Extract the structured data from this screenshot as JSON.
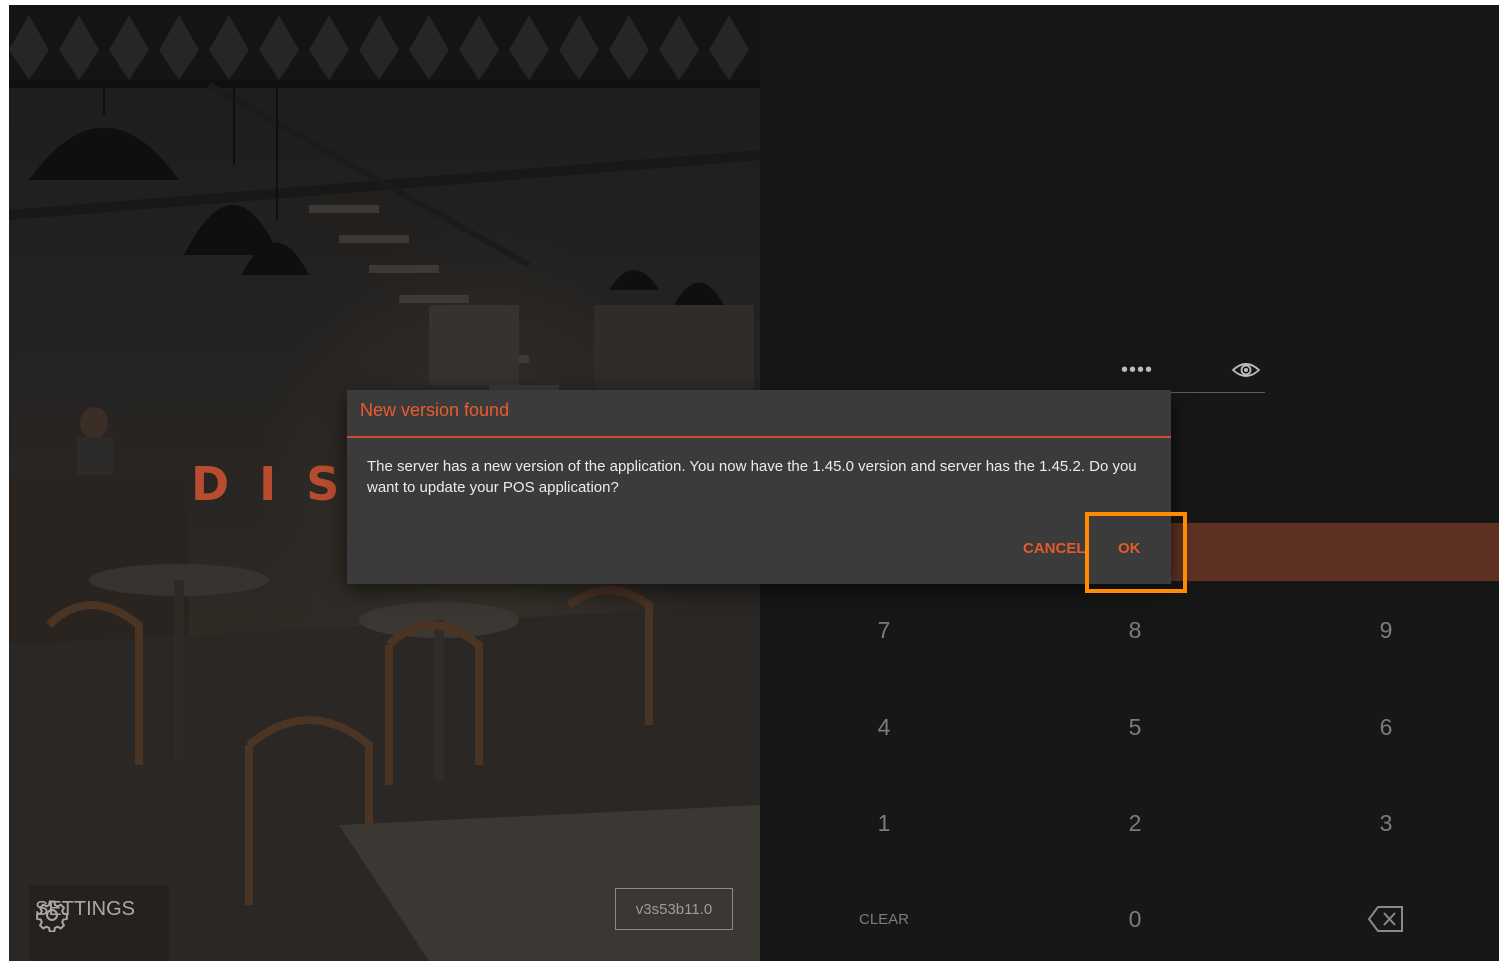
{
  "left_panel": {
    "brand_partial": "DIS",
    "settings_label": "SETTINGS",
    "version_label": "v3s53b11.0"
  },
  "pin": {
    "masked_value": "••••",
    "toggle_icon": "eye-icon"
  },
  "keypad": {
    "keys": [
      "7",
      "8",
      "9",
      "4",
      "5",
      "6",
      "1",
      "2",
      "3",
      "CLEAR",
      "0"
    ],
    "backspace_icon": "backspace-icon"
  },
  "dialog": {
    "title": "New version found",
    "message": "The server has a new version of the application. You now have the 1.45.0 version and server has the 1.45.2. Do you want to update your POS application?",
    "cancel_label": "CANCEL",
    "ok_label": "OK"
  },
  "colors": {
    "accent": "#e45a2c",
    "login_bar": "#5e3123",
    "highlight": "#ff8c00"
  }
}
